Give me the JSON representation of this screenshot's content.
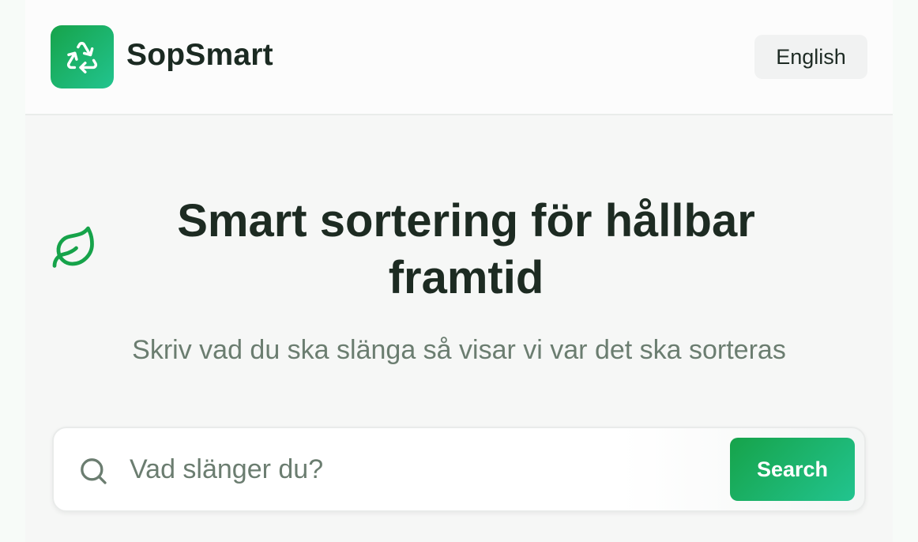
{
  "header": {
    "brand": "SopSmart",
    "language_button": "English",
    "logo_icon": "recycle-icon"
  },
  "hero": {
    "decoration_icon": "leaf-icon",
    "title": "Smart sortering för hållbar framtid",
    "subtitle": "Skriv vad du ska slänga så visar vi var det ska sorteras"
  },
  "search": {
    "icon": "search-icon",
    "placeholder": "Vad slänger du?",
    "value": "",
    "button_label": "Search"
  },
  "colors": {
    "accent_start": "#16a34a",
    "accent_end": "#22c48f",
    "text_dark": "#1d2b22",
    "text_muted": "#6b7d70"
  }
}
